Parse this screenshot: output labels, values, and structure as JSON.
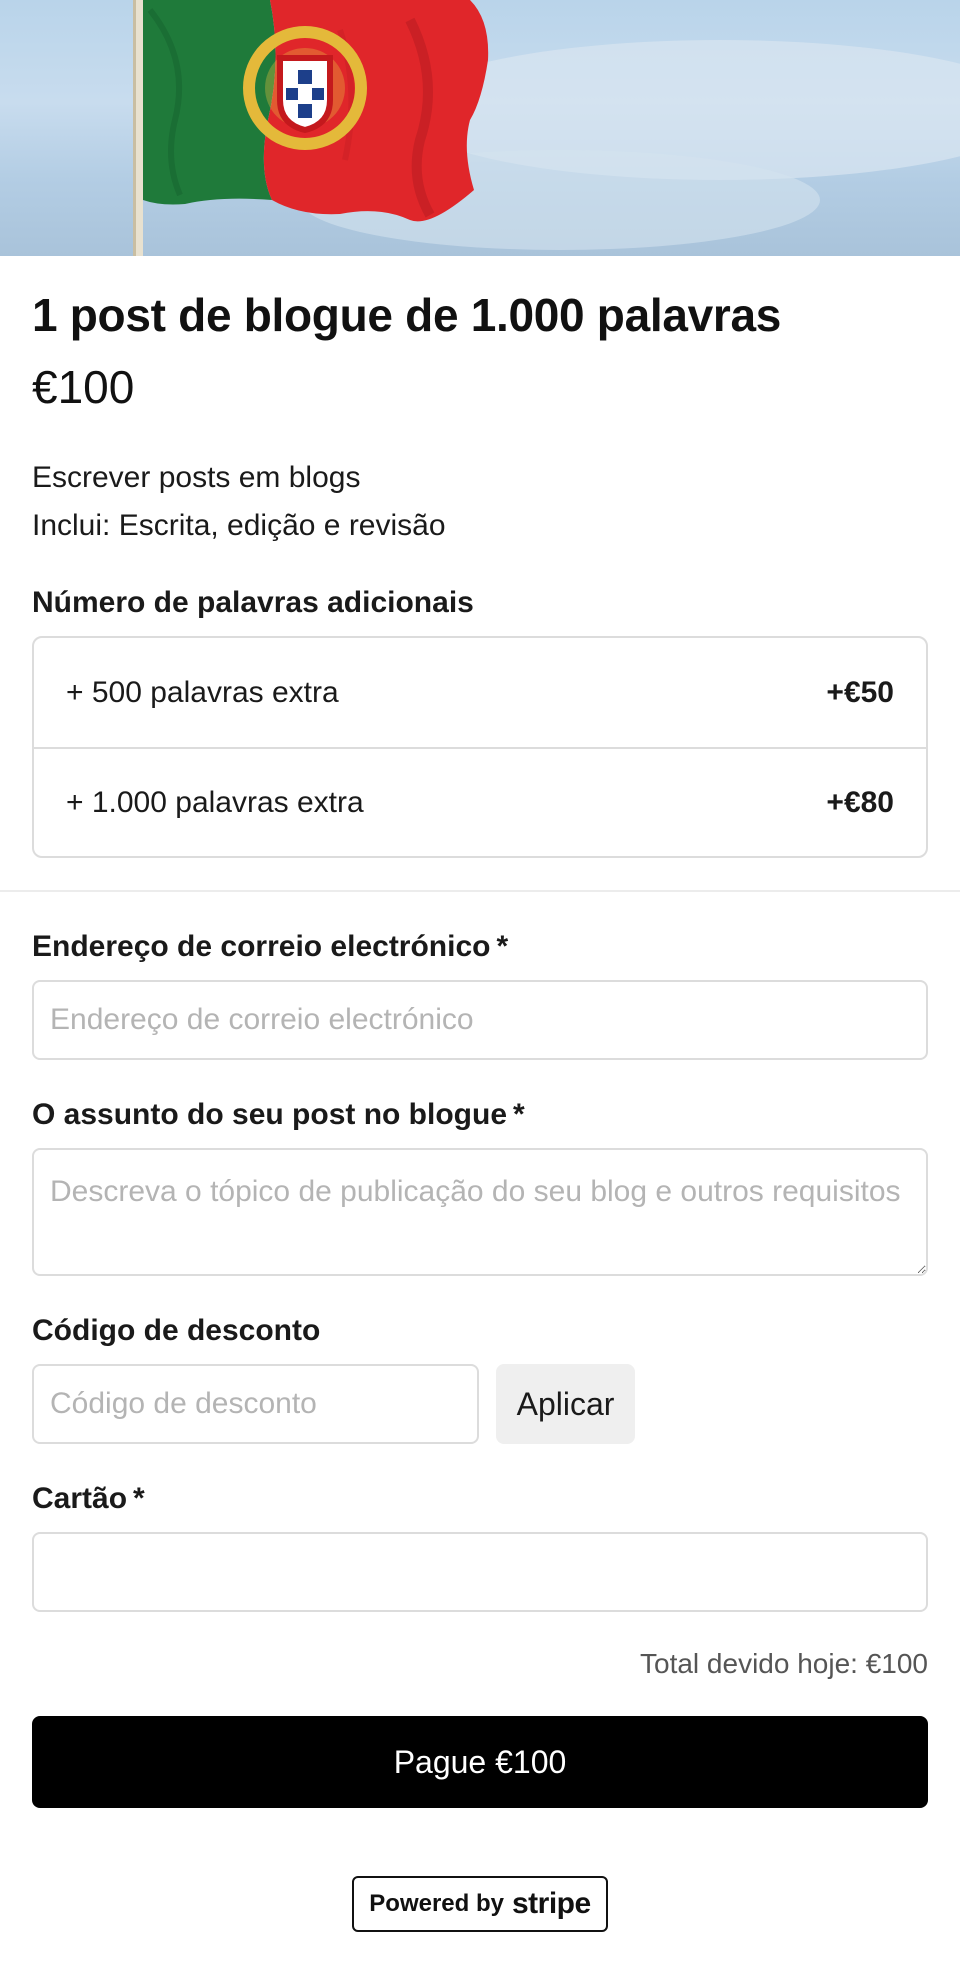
{
  "product": {
    "title": "1 post de blogue de 1.000 palavras",
    "price": "€100",
    "description_lines": [
      "Escrever posts em blogs",
      "Inclui: Escrita, edição e revisão"
    ]
  },
  "addons": {
    "label": "Número de palavras adicionais",
    "options": [
      {
        "label": "+ 500 palavras extra",
        "price": "+€50"
      },
      {
        "label": "+ 1.000 palavras extra",
        "price": "+€80"
      }
    ]
  },
  "form": {
    "email": {
      "label": "Endereço de correio electrónico",
      "required_mark": "*",
      "placeholder": "Endereço de correio electrónico",
      "value": ""
    },
    "topic": {
      "label": "O assunto do seu post no blogue",
      "required_mark": "*",
      "placeholder": "Descreva o tópico de publicação do seu blog e outros requisitos",
      "value": ""
    },
    "discount": {
      "label": "Código de desconto",
      "placeholder": "Código de desconto",
      "value": "",
      "apply_label": "Aplicar"
    },
    "card": {
      "label": "Cartão",
      "required_mark": "*",
      "value": ""
    }
  },
  "summary": {
    "total_text": "Total devido hoje: €100",
    "pay_label": "Pague €100"
  },
  "footer": {
    "powered_by": "Powered by",
    "brand": "stripe"
  },
  "hero": {
    "icon": "portugal-flag-image",
    "colors": {
      "green": "#1f7a3a",
      "red": "#e0262a",
      "sky": "#bcd5ea"
    }
  }
}
